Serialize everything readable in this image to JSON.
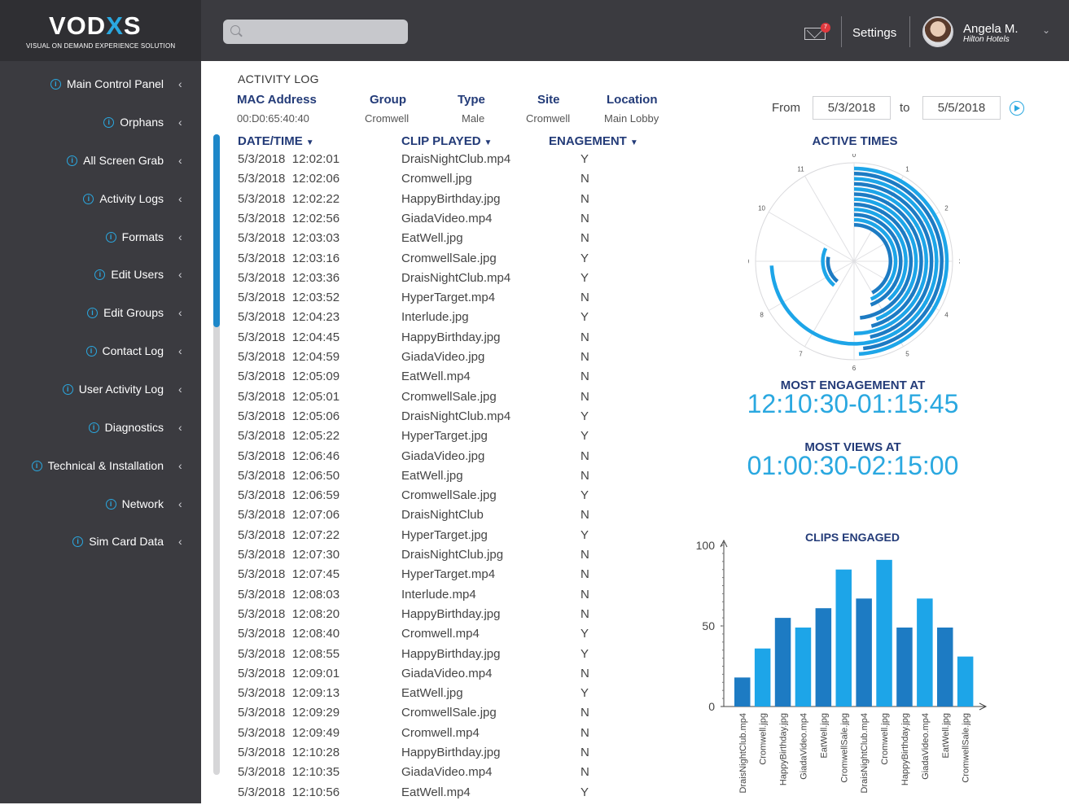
{
  "brand": {
    "logo": "VODXS",
    "tagline": "VISUAL ON DEMAND EXPERIENCE SOLUTION"
  },
  "colors": {
    "accent": "#2aa8e0",
    "navy": "#233b78",
    "sidebar": "#3b3b40",
    "bar_dark": "#1d7bc3",
    "bar_light": "#1da5e8"
  },
  "sidebar": {
    "items": [
      {
        "label": "Main Control Panel"
      },
      {
        "label": "Orphans"
      },
      {
        "label": "All Screen Grab"
      },
      {
        "label": "Activity Logs"
      },
      {
        "label": "Formats"
      },
      {
        "label": "Edit Users"
      },
      {
        "label": "Edit Groups"
      },
      {
        "label": "Contact Log"
      },
      {
        "label": "User Activity Log"
      },
      {
        "label": "Diagnostics"
      },
      {
        "label": "Technical & Installation"
      },
      {
        "label": "Network"
      },
      {
        "label": "Sim Card Data"
      }
    ]
  },
  "topbar": {
    "search_placeholder": "",
    "mail_count": "7",
    "settings_label": "Settings",
    "user_name": "Angela M.",
    "user_org": "Hilton Hotels"
  },
  "log": {
    "title": "ACTIVITY LOG",
    "info": {
      "mac_label": "MAC Address",
      "mac_value": "00:D0:65:40:40",
      "group_label": "Group",
      "group_value": "Cromwell",
      "type_label": "Type",
      "type_value": "Male",
      "site_label": "Site",
      "site_value": "Cromwell",
      "location_label": "Location",
      "location_value": "Main Lobby"
    },
    "columns": {
      "date": "DATE/TIME",
      "clip": "CLIP PLAYED",
      "engagement": "ENAGEMENT"
    },
    "rows": [
      [
        "5/3/2018  12:02:01",
        "DraisNightClub.mp4",
        "Y"
      ],
      [
        "5/3/2018  12:02:06",
        "Cromwell.jpg",
        "N"
      ],
      [
        "5/3/2018  12:02:22",
        "HappyBirthday.jpg",
        "N"
      ],
      [
        "5/3/2018  12:02:56",
        "GiadaVideo.mp4",
        "N"
      ],
      [
        "5/3/2018  12:03:03",
        "EatWell.jpg",
        "N"
      ],
      [
        "5/3/2018  12:03:16",
        "CromwellSale.jpg",
        "Y"
      ],
      [
        "5/3/2018  12:03:36",
        "DraisNightClub.mp4",
        "Y"
      ],
      [
        "5/3/2018  12:03:52",
        "HyperTarget.mp4",
        "N"
      ],
      [
        "5/3/2018  12:04:23",
        "Interlude.jpg",
        "Y"
      ],
      [
        "5/3/2018  12:04:45",
        "HappyBirthday.jpg",
        "N"
      ],
      [
        "5/3/2018  12:04:59",
        "GiadaVideo.jpg",
        "N"
      ],
      [
        "5/3/2018  12:05:09",
        "EatWell.mp4",
        "N"
      ],
      [
        "5/3/2018  12:05:01",
        "CromwellSale.jpg",
        "N"
      ],
      [
        "5/3/2018  12:05:06",
        "DraisNightClub.mp4",
        "Y"
      ],
      [
        "5/3/2018  12:05:22",
        "HyperTarget.jpg",
        "Y"
      ],
      [
        "5/3/2018  12:06:46",
        "GiadaVideo.jpg",
        "N"
      ],
      [
        "5/3/2018  12:06:50",
        "EatWell.jpg",
        "N"
      ],
      [
        "5/3/2018  12:06:59",
        "CromwellSale.jpg",
        "Y"
      ],
      [
        "5/3/2018  12:07:06",
        "DraisNightClub",
        "N"
      ],
      [
        "5/3/2018  12:07:22",
        "HyperTarget.jpg",
        "Y"
      ],
      [
        "5/3/2018  12:07:30",
        "DraisNightClub.jpg",
        "N"
      ],
      [
        "5/3/2018  12:07:45",
        "HyperTarget.mp4",
        "N"
      ],
      [
        "5/3/2018  12:08:03",
        "Interlude.mp4",
        "N"
      ],
      [
        "5/3/2018  12:08:20",
        "HappyBirthday.jpg",
        "N"
      ],
      [
        "5/3/2018  12:08:40",
        "Cromwell.mp4",
        "Y"
      ],
      [
        "5/3/2018  12:08:55",
        "HappyBirthday.jpg",
        "Y"
      ],
      [
        "5/3/2018  12:09:01",
        "GiadaVideo.mp4",
        "N"
      ],
      [
        "5/3/2018  12:09:13",
        "EatWell.jpg",
        "Y"
      ],
      [
        "5/3/2018  12:09:29",
        "CromwellSale.jpg",
        "N"
      ],
      [
        "5/3/2018  12:09:49",
        "Cromwell.mp4",
        "N"
      ],
      [
        "5/3/2018  12:10:28",
        "HappyBirthday.jpg",
        "N"
      ],
      [
        "5/3/2018  12:10:35",
        "GiadaVideo.mp4",
        "N"
      ],
      [
        "5/3/2018  12:10:56",
        "EatWell.mp4",
        "Y"
      ]
    ]
  },
  "filter": {
    "from_label": "From",
    "from_value": "5/3/2018",
    "to_label": "to",
    "to_value": "5/5/2018"
  },
  "active_times": {
    "title": "ACTIVE TIMES",
    "hour_labels": [
      "0",
      "1",
      "2",
      "3",
      "4",
      "5",
      "6",
      "7",
      "8",
      "9",
      "10",
      "11"
    ]
  },
  "stats": {
    "engagement_label": "MOST ENGAGEMENT AT",
    "engagement_value": "12:10:30-01:15:45",
    "views_label": "MOST VIEWS AT",
    "views_value": "01:00:30-02:15:00"
  },
  "chart_data": [
    {
      "type": "radial-bar",
      "title": "ACTIVE TIMES",
      "axis_labels": [
        "0",
        "1",
        "2",
        "3",
        "4",
        "5",
        "6",
        "7",
        "8",
        "9",
        "10",
        "11"
      ],
      "axis_range": [
        0,
        12
      ],
      "series": [
        {
          "values": [
            5.9
          ]
        },
        {
          "values": [
            5.8
          ]
        },
        {
          "values": [
            8.9
          ]
        },
        {
          "values": [
            5.6
          ]
        },
        {
          "values": [
            6.0
          ]
        },
        {
          "values": [
            5.5
          ]
        },
        {
          "values": [
            5.3
          ]
        },
        {
          "values": [
            5.8
          ]
        },
        {
          "values": [
            4.6
          ]
        },
        {
          "values": [
            5.3
          ]
        },
        {
          "values": [
            5.2
          ]
        },
        {
          "values": [
            5.0
          ]
        },
        {
          "values": [
            2.5
          ]
        },
        {
          "values": [
            2.0
          ]
        }
      ]
    },
    {
      "type": "bar",
      "title": "CLIPS ENGAGED",
      "categories": [
        "DraisNightClub.mp4",
        "Cromwell.jpg",
        "HappyBirthday.jpg",
        "GiadaVideo.mp4",
        "EatWell.jpg",
        "CromwellSale.jpg",
        "DraisNightClub.mp4",
        "Cromwell.jpg",
        "HappyBirthday.jpg",
        "GiadaVideo.mp4",
        "EatWell.jpg",
        "CromwellSale.jpg"
      ],
      "values": [
        18,
        36,
        55,
        49,
        61,
        85,
        67,
        91,
        49,
        67,
        49,
        31
      ],
      "yticks": [
        0,
        50,
        100
      ],
      "ylim": [
        0,
        100
      ],
      "xlabel": "",
      "ylabel": ""
    }
  ]
}
